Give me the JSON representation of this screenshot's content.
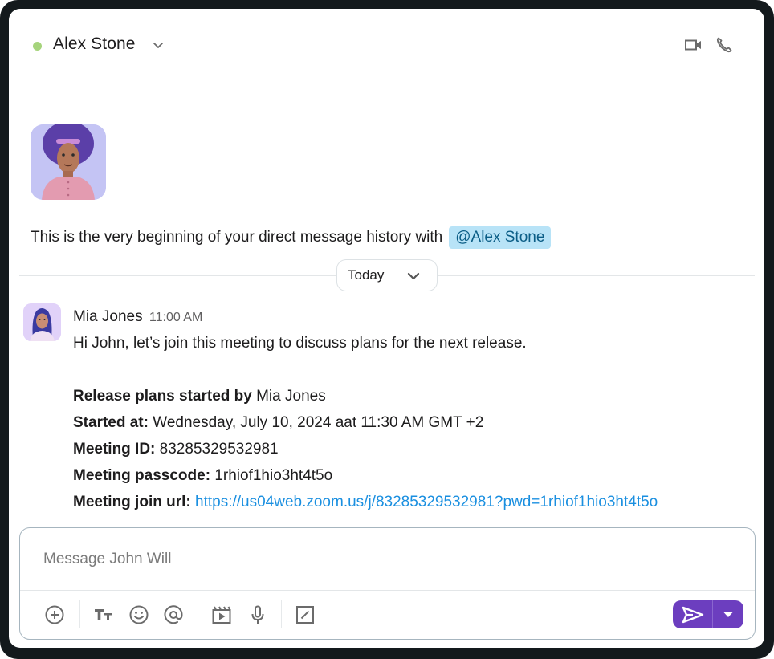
{
  "header": {
    "title": "Alex Stone",
    "presence": "online",
    "presence_color": "#a6d47c",
    "icons": [
      "chevron-down-icon",
      "video-camera-icon",
      "phone-icon"
    ]
  },
  "intro": {
    "text": "This is the very beginning of your direct message history with",
    "mention": "@Alex Stone"
  },
  "day_divider": {
    "label": "Today"
  },
  "message": {
    "author": "Mia Jones",
    "time": "11:00 AM",
    "text": "Hi John, let’s join this meeting to discuss plans for the next release.",
    "details": {
      "started_by_label": "Release plans started by",
      "started_by_value": "Mia Jones",
      "started_at_label": "Started at:",
      "started_at_value": "Wednesday, July 10, 2024 aat 11:30 AM GMT +2",
      "meeting_id_label": "Meeting ID:",
      "meeting_id_value": "83285329532981",
      "passcode_label": "Meeting passcode:",
      "passcode_value": "1rhiof1hio3ht4t5o",
      "join_url_label": "Meeting join url:",
      "join_url_value": "https://us04web.zoom.us/j/83285329532981?pwd=1rhiof1hio3ht4t5o"
    }
  },
  "composer": {
    "placeholder": "Message John Will",
    "value": "",
    "toolbar": [
      "add-icon",
      "text-format-icon",
      "emoji-icon",
      "mention-icon",
      "video-clip-icon",
      "microphone-icon",
      "shortcut-icon"
    ],
    "send_color": "#6c3ebf"
  },
  "colors": {
    "accent": "#6c3ebf",
    "link": "#1a8fe0",
    "mention_bg": "#b8e3f7",
    "mention_text": "#0b5d86"
  }
}
